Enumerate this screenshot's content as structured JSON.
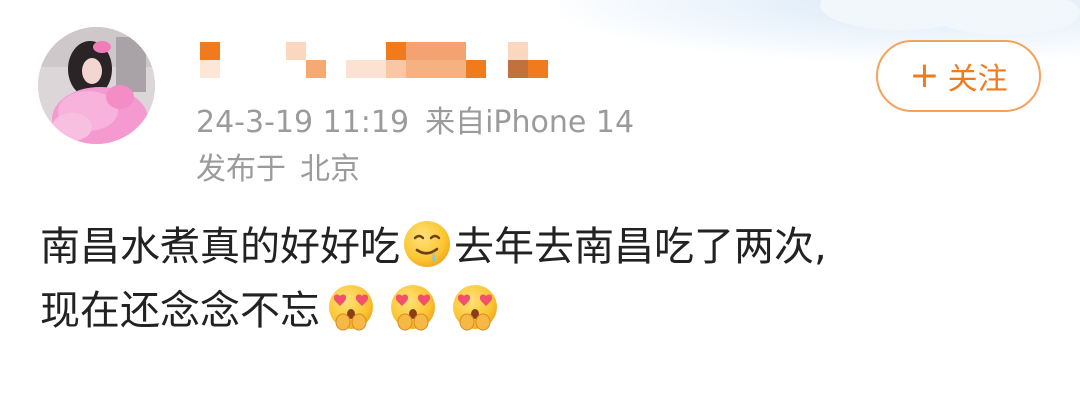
{
  "post": {
    "author": {
      "name_obscured": true
    },
    "timestamp": "24-3-19 11:19",
    "source": "来自iPhone 14",
    "location_prefix": "发布于",
    "location": "北京",
    "follow_button": {
      "label": "关注",
      "icon": "plus-icon"
    },
    "text_line_1": "南昌水煮真的好好吃",
    "text_line_1b": "去年去南昌吃了两次,",
    "text_line_2": "现在还念念不忘",
    "emojis": {
      "drooling": "drooling-face-emoji",
      "heart_eyes": "heart-eyes-hands-emoji"
    }
  },
  "colors": {
    "accent": "#f07b1d",
    "meta_text": "#9b9b9b",
    "body_text": "#222222"
  }
}
